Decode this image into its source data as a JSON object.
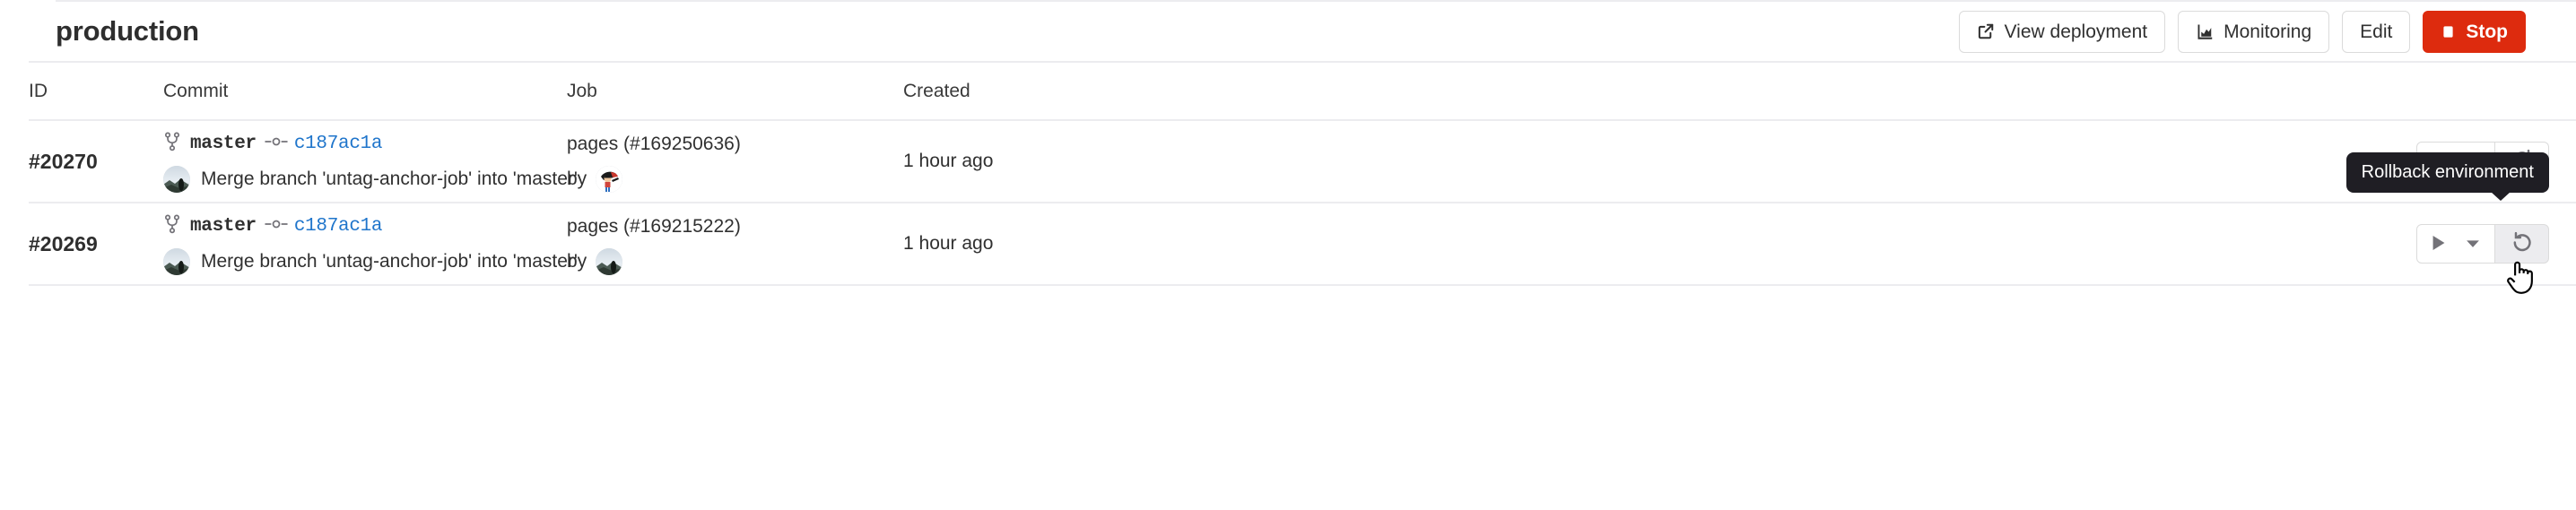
{
  "header": {
    "title": "production",
    "actions": [
      {
        "id": "view-deployment",
        "label": "View deployment",
        "icon": "external-link-icon",
        "style": "default"
      },
      {
        "id": "monitoring",
        "label": "Monitoring",
        "icon": "chart-icon",
        "style": "default"
      },
      {
        "id": "edit",
        "label": "Edit",
        "icon": "",
        "style": "default"
      },
      {
        "id": "stop",
        "label": "Stop",
        "icon": "stop-square-icon",
        "style": "danger"
      }
    ]
  },
  "colors": {
    "danger": "#dd2b0e",
    "link": "#1f75cb",
    "border": "#ececef",
    "tooltip_bg": "#1f1e24",
    "icon_gray": "#737278"
  },
  "table": {
    "columns": [
      "ID",
      "Commit",
      "Job",
      "Created"
    ],
    "rows": [
      {
        "id": "#20270",
        "branch": "master",
        "sha": "c187ac1a",
        "commit_message": "Merge branch 'untag-anchor-job' into 'master'",
        "job_name": "pages (#169250636)",
        "job_by_label": "by",
        "created": "1 hour ago",
        "actions": {
          "play_label": "play-button",
          "dropdown_label": "play-dropdown",
          "right_icon": "re-deploy-icon",
          "right_hovered": false
        }
      },
      {
        "id": "#20269",
        "branch": "master",
        "sha": "c187ac1a",
        "commit_message": "Merge branch 'untag-anchor-job' into 'master'",
        "job_name": "pages (#169215222)",
        "job_by_label": "by",
        "created": "1 hour ago",
        "actions": {
          "play_label": "play-button",
          "dropdown_label": "play-dropdown",
          "right_icon": "rollback-icon",
          "right_hovered": true
        }
      }
    ]
  },
  "tooltip": {
    "text": "Rollback environment"
  }
}
